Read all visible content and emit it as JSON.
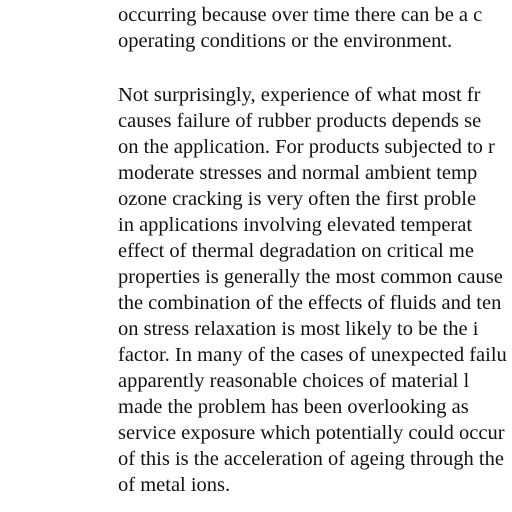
{
  "paragraph_1": {
    "lines": [
      "occurring because over time there can be a c",
      "operating conditions or the environment."
    ]
  },
  "paragraph_2": {
    "lines": [
      "Not surprisingly, experience of what most fr",
      "causes failure of rubber products depends se",
      "on the application. For products subjected to r",
      "moderate stresses and normal ambient temp",
      "ozone cracking is very often the first proble",
      "in applications involving elevated temperat",
      "effect of thermal degradation on critical me",
      "properties is generally the most common cause",
      "the combination of the effects of fluids and ten",
      "on stress relaxation is most likely to be the i",
      "factor. In many of the cases of unexpected failu",
      "apparently reasonable choices of material l",
      "made the problem has been overlooking as",
      "service exposure which potentially could occur",
      "of this is the acceleration of ageing through the",
      "of metal ions."
    ]
  }
}
